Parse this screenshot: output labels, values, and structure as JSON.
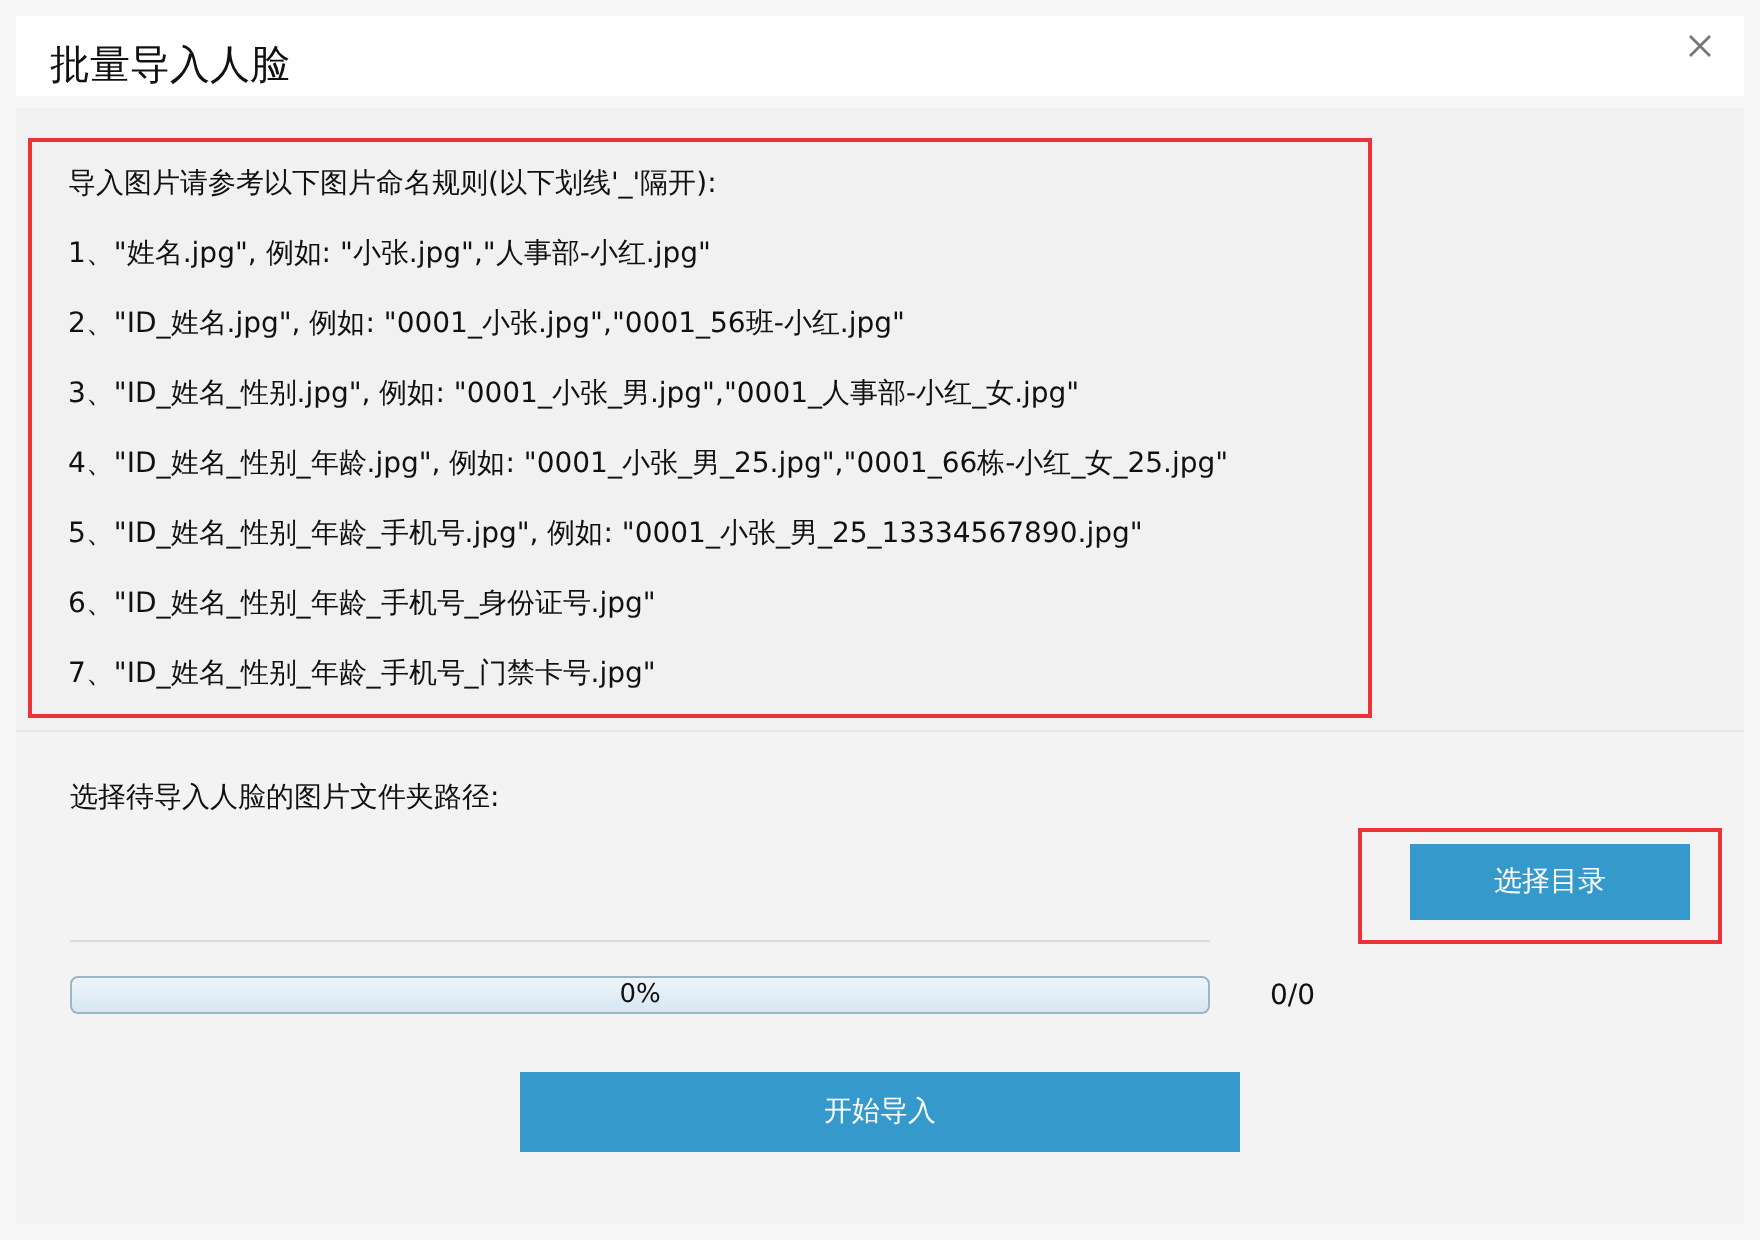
{
  "dialog": {
    "title": "批量导入人脸"
  },
  "rules": {
    "intro": "导入图片请参考以下图片命名规则(以下划线'_'隔开):",
    "items": [
      "1、\"姓名.jpg\", 例如: \"小张.jpg\",\"人事部-小红.jpg\"",
      "2、\"ID_姓名.jpg\", 例如: \"0001_小张.jpg\",\"0001_56班-小红.jpg\"",
      "3、\"ID_姓名_性别.jpg\", 例如: \"0001_小张_男.jpg\",\"0001_人事部-小红_女.jpg\"",
      "4、\"ID_姓名_性别_年龄.jpg\", 例如: \"0001_小张_男_25.jpg\",\"0001_66栋-小红_女_25.jpg\"",
      "5、\"ID_姓名_性别_年龄_手机号.jpg\", 例如: \"0001_小张_男_25_13334567890.jpg\"",
      "6、\"ID_姓名_性别_年龄_手机号_身份证号.jpg\"",
      "7、\"ID_姓名_性别_年龄_手机号_门禁卡号.jpg\""
    ]
  },
  "folder": {
    "label": "选择待导入人脸的图片文件夹路径:",
    "browse_button": "选择目录"
  },
  "progress": {
    "level": 0,
    "percent": "0%",
    "count": "0/0"
  },
  "start_button": "开始导入"
}
